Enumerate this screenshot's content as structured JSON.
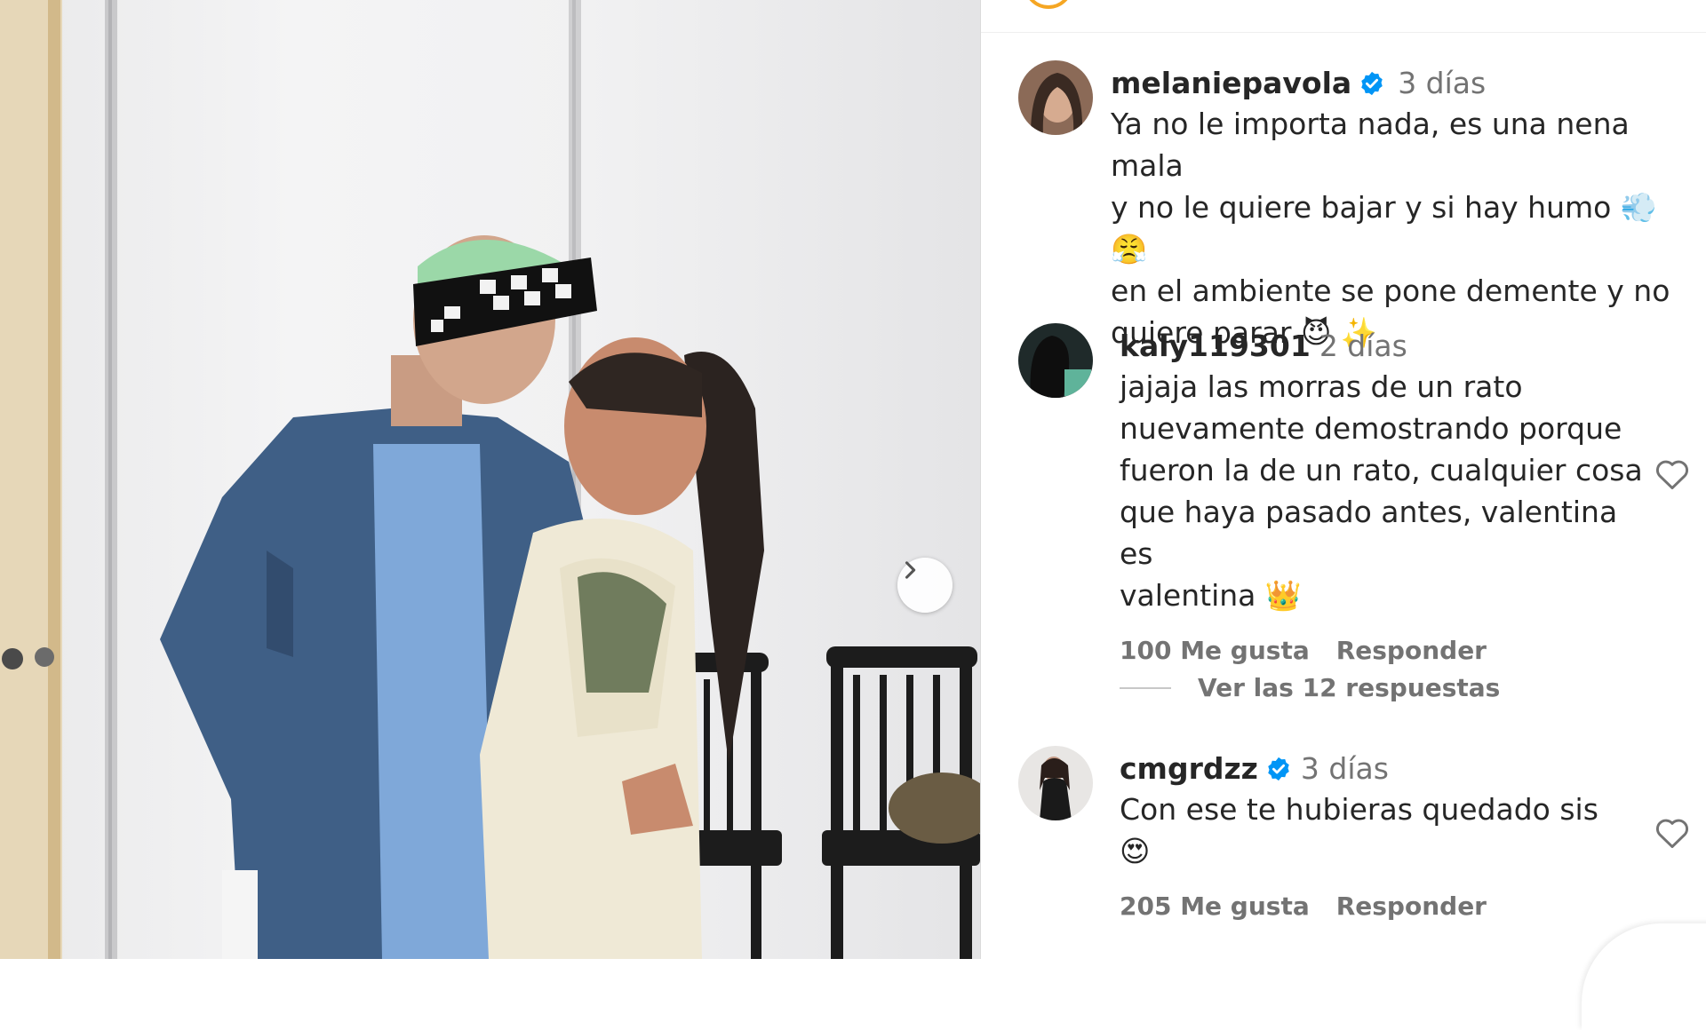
{
  "post": {
    "photo_alt": "photo",
    "next_icon": "chevron-right-icon"
  },
  "comments": [
    {
      "username": "melaniepavola",
      "verified": true,
      "time": "3 días",
      "text_lines": [
        "Ya no le importa nada, es una nena mala",
        "y no le quiere bajar y si hay humo 💨 😤",
        "en el ambiente se pone demente y no",
        "quiere parar 😈 ✨"
      ]
    },
    {
      "username": "kaly119301",
      "verified": false,
      "time": "2 días",
      "text_lines": [
        "jajaja las morras de un rato",
        "nuevamente demostrando porque",
        "fueron la de un rato, cualquier cosa",
        "que haya pasado antes, valentina es",
        "valentina 👑"
      ],
      "likes": "100 Me gusta",
      "reply": "Responder",
      "view_replies": "Ver las 12 respuestas"
    },
    {
      "username": "cmgrdzz",
      "verified": true,
      "time": "3 días",
      "text_lines": [
        "Con ese te hubieras quedado sis",
        "😍"
      ],
      "likes": "205 Me gusta",
      "reply": "Responder"
    }
  ],
  "colors": {
    "verified": "#0095f6",
    "muted": "#737373",
    "text": "#262626"
  }
}
